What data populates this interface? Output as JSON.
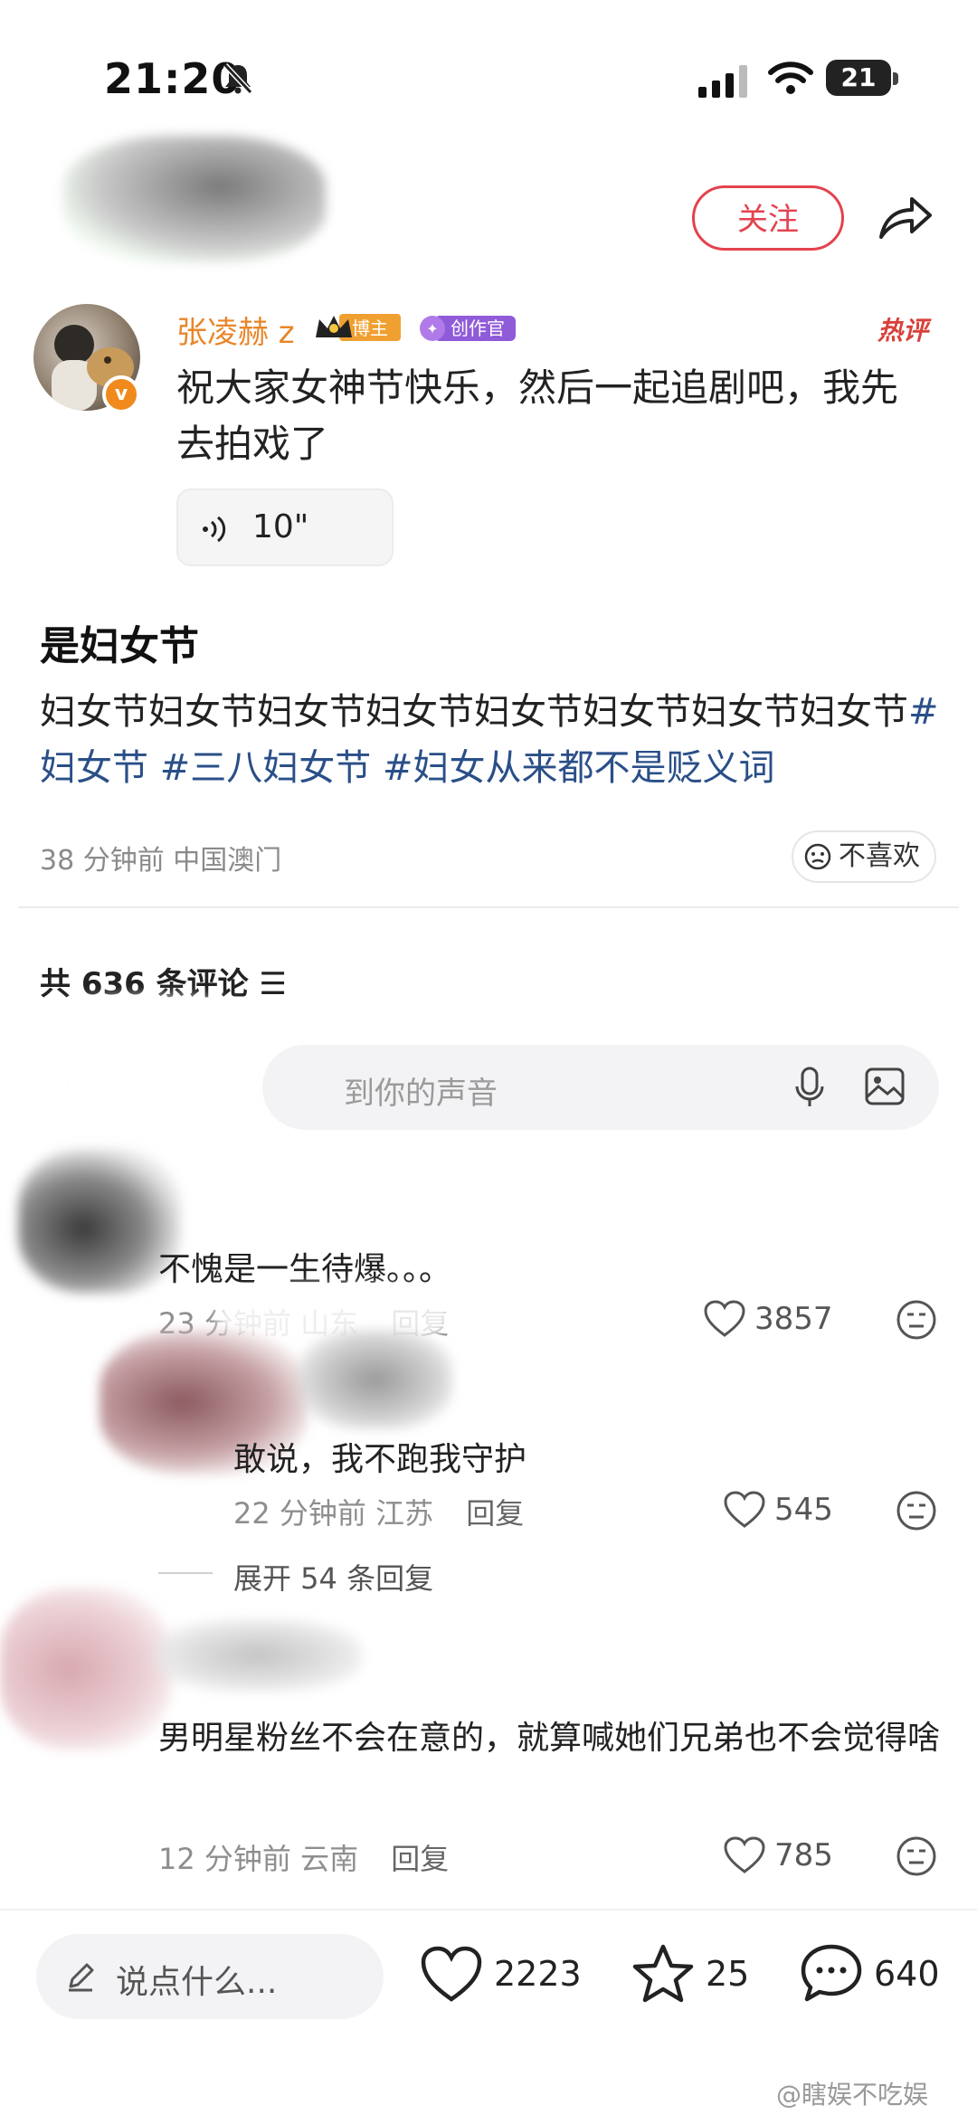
{
  "status_bar": {
    "time": "21:20",
    "battery": "21"
  },
  "header": {
    "follow_label": "关注"
  },
  "post": {
    "username": "张凌赫 z",
    "badge_blogger": "博主",
    "badge_creator": "创作官",
    "hot_tag": "热评",
    "text": "祝大家女神节快乐，然后一起追剧吧，我先去拍戏了",
    "voice_duration": "10\""
  },
  "article": {
    "title": "是妇女节",
    "body": "妇女节妇女节妇女节妇女节妇女节妇女节妇女节妇女节",
    "hashtags": [
      "#妇女节",
      "#三八妇女节",
      "#妇女从来都不是贬义词"
    ],
    "meta": "38 分钟前  中国澳门",
    "dislike_label": "不喜欢"
  },
  "comments_header": {
    "count_label": "共 636 条评论",
    "input_placeholder": "到你的声音"
  },
  "comments": [
    {
      "text": "不愧是一生待爆。。。",
      "time": "23 分钟前",
      "location": "山东",
      "reply": "回复",
      "likes": "3857"
    },
    {
      "text": "敢说，我不跑我守护",
      "time": "22 分钟前",
      "location": "江苏",
      "reply": "回复",
      "likes": "545",
      "expand": "展开 54 条回复"
    },
    {
      "text": "男明星粉丝不会在意的，就算喊她们兄弟也不会觉得啥",
      "time": "12 分钟前",
      "location": "云南",
      "reply": "回复",
      "likes": "785"
    }
  ],
  "bottom_bar": {
    "say_placeholder": "说点什么...",
    "likes": "2223",
    "favorites": "25",
    "comments": "640"
  },
  "watermark": "@瞎娱不吃娱",
  "colors": {
    "accent_red": "#e3434f",
    "username_orange": "#e8862a",
    "hashtag_blue": "#2a4f88"
  }
}
